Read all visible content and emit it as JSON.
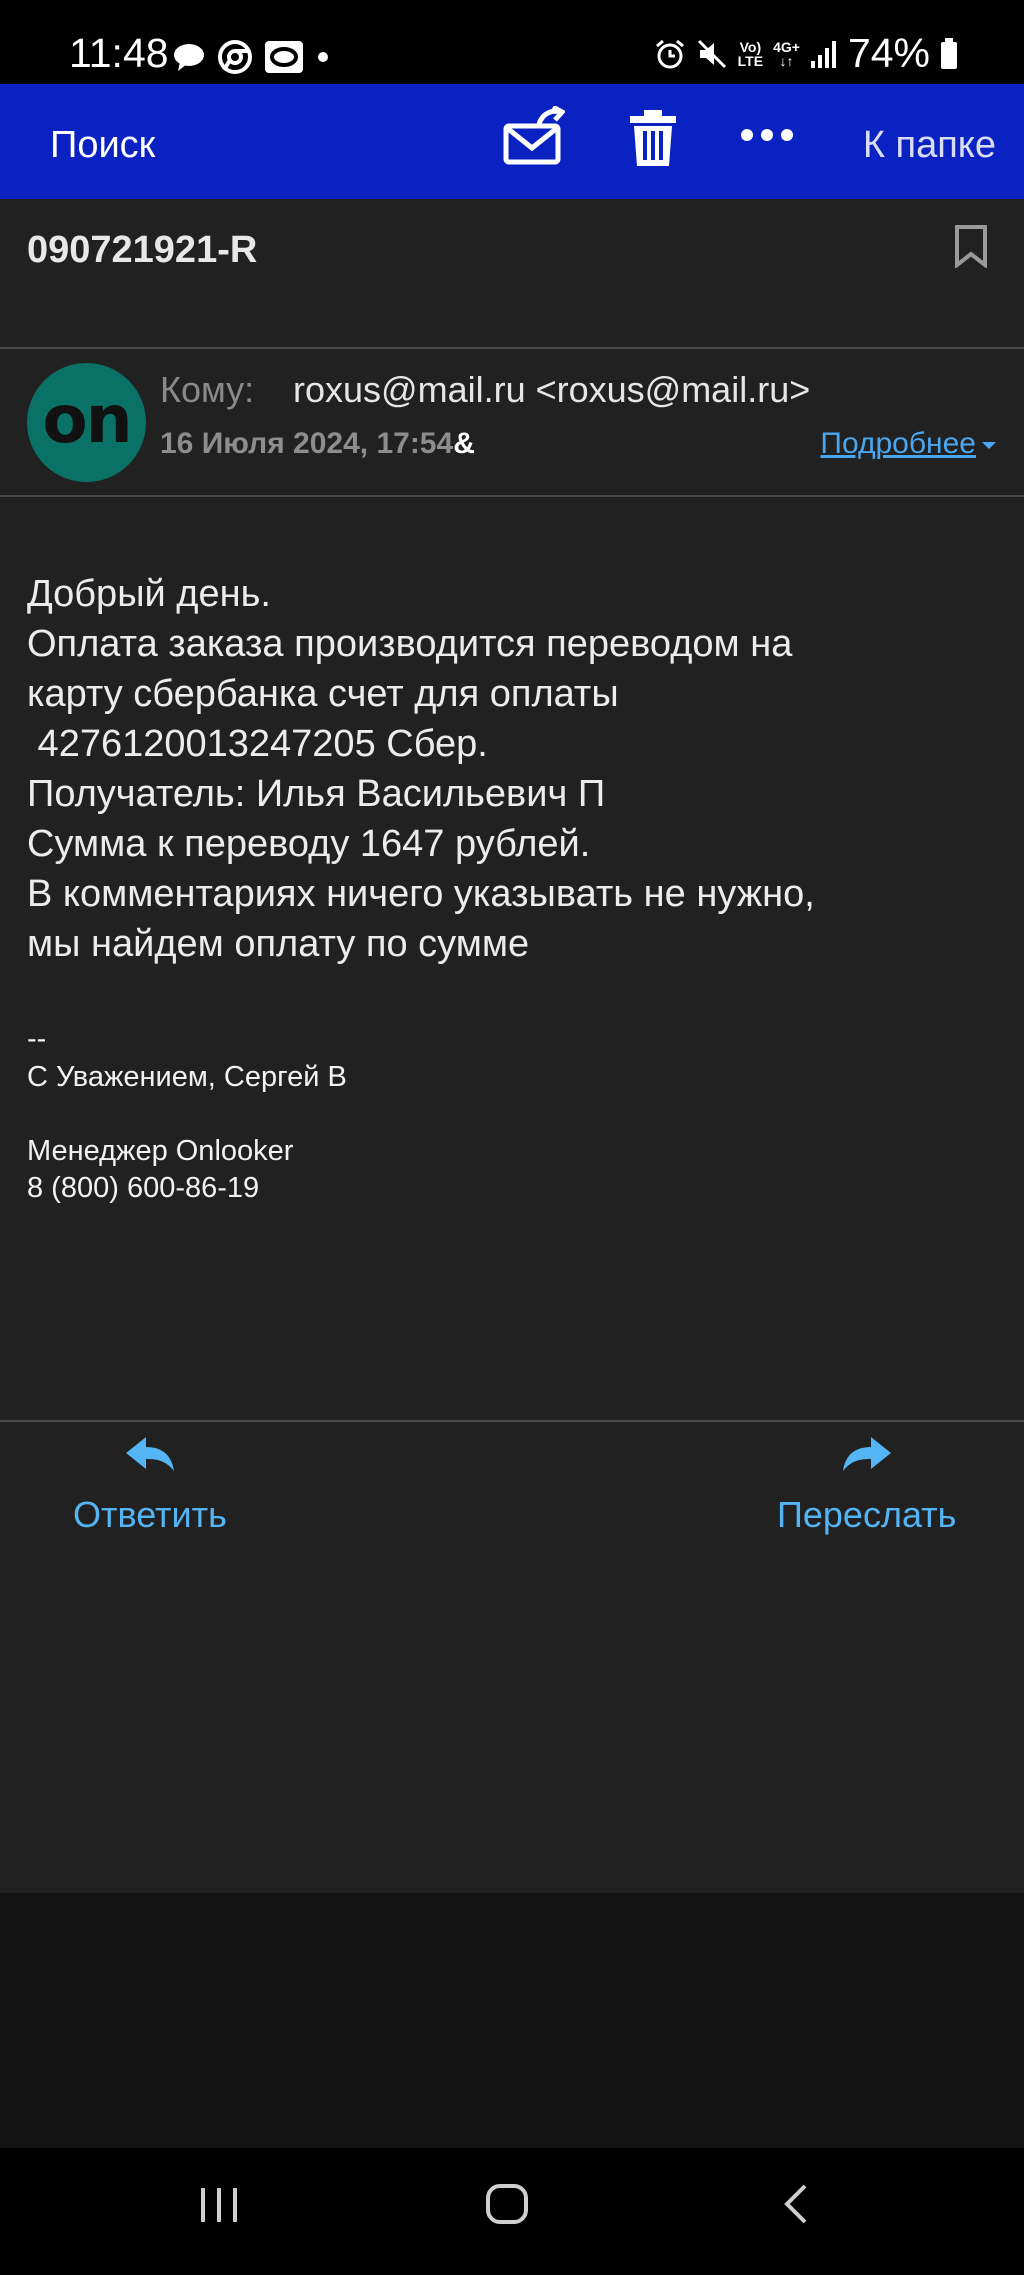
{
  "status_bar": {
    "time": "11:48",
    "left_icons": [
      "chat-bubble-icon",
      "chrome-icon",
      "app-o-icon",
      "dot-icon"
    ],
    "right_icons": [
      "alarm-icon",
      "mute-icon",
      "volte-icon",
      "4g-icon",
      "signal-icon",
      "battery-icon"
    ],
    "volte_line1": "Vo)",
    "volte_line2": "LTE",
    "net_type": "4G+",
    "battery": "74%"
  },
  "toolbar": {
    "search_label": "Поиск",
    "folder_label": "К папке",
    "icons": [
      "mark-unread-icon",
      "trash-icon",
      "more-icon"
    ]
  },
  "email": {
    "subject": "090721921-R",
    "avatar_text": "on",
    "to_label": "Кому:",
    "to_value": "roxus@mail.ru <roxus@mail.ru>",
    "date": "16 Июля 2024, 17:54",
    "date_suffix": "&",
    "details_label": "Подробнее",
    "body_lines": [
      "Добрый день.",
      "Оплата заказа производится переводом на",
      "карту сбербанка счет для оплаты",
      " 4276120013247205 Сбер.",
      "Получатель: Илья Васильевич П",
      "Сумма к переводу 1647 рублей.",
      "В комментариях ничего указывать не нужно,",
      "мы найдем оплату по сумме"
    ],
    "signature": {
      "separator": "--",
      "regards": "С Уважением, Сергей В",
      "title": "Менеджер Onlooker",
      "phone": "8 (800) 600-86-19"
    }
  },
  "actions": {
    "reply_label": "Ответить",
    "forward_label": "Переслать"
  },
  "colors": {
    "toolbar_bg": "#0b22c2",
    "background": "#212121",
    "accent_link": "#4aa7ef",
    "action_blue": "#55b4f4",
    "avatar_bg": "#0a7166"
  },
  "navbar": {
    "buttons": [
      "recents-icon",
      "home-icon",
      "back-icon"
    ]
  }
}
